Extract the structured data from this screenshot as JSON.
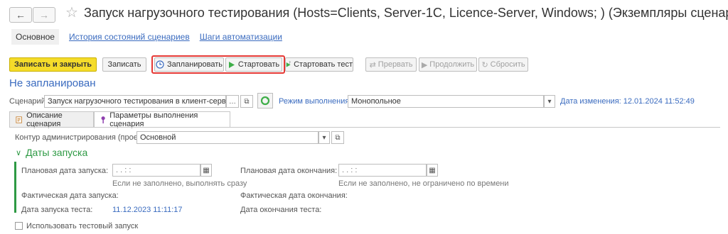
{
  "window": {
    "title": "Запуск нагрузочного тестирования (Hosts=Clients, Server-1C, Licence-Server, Windows; ) (Экземпляры сценариев)"
  },
  "nav": {
    "back_icon": "arrow-left-icon",
    "forward_icon": "arrow-right-icon",
    "favorite_icon": "star-icon"
  },
  "tabs": [
    {
      "label": "Основное"
    },
    {
      "label": "История состояний сценариев"
    },
    {
      "label": "Шаги автоматизации"
    }
  ],
  "toolbar": {
    "save_close": "Записать и закрыть",
    "save": "Записать",
    "schedule": "Запланировать",
    "start": "Стартовать",
    "start_test": "Стартовать тест",
    "interrupt": "Прервать",
    "continue": "Продолжить",
    "reset": "Сбросить"
  },
  "status": "Не запланирован",
  "scenario": {
    "label": "Сценарий:",
    "value": "Запуск нагрузочного тестирования в клиент-серверном",
    "mode_label": "Режим выполнения:",
    "mode_value": "Монопольное",
    "changed": "Дата изменения: 12.01.2024 11:52:49"
  },
  "inner_tabs": [
    {
      "label": "Описание сценария"
    },
    {
      "label": "Параметры выполнения сценария"
    }
  ],
  "params": {
    "contour_label": "Контур администрирования (проект):",
    "contour_value": "Основной",
    "section_title": "Даты запуска",
    "planned_start_label": "Плановая дата запуска:",
    "planned_start_value": " .  .       :  :",
    "planned_start_hint": "Если не заполнено, выполнять сразу",
    "planned_end_label": "Плановая дата окончания:",
    "planned_end_value": " .  .       :  :",
    "planned_end_hint": "Если не заполнено, не ограничено по времени",
    "actual_start_label": "Фактическая дата запуска:",
    "actual_end_label": "Фактическая дата окончания:",
    "test_start_label": "Дата запуска теста:",
    "test_start_value": "11.12.2023 11:11:17",
    "test_end_label": "Дата окончания теста:",
    "use_test_label": "Использовать тестовый запуск"
  },
  "colors": {
    "accent": "#3a6bbf",
    "primary_button": "#f5dc2a",
    "highlight": "#e53935",
    "section": "#2e9a44"
  }
}
